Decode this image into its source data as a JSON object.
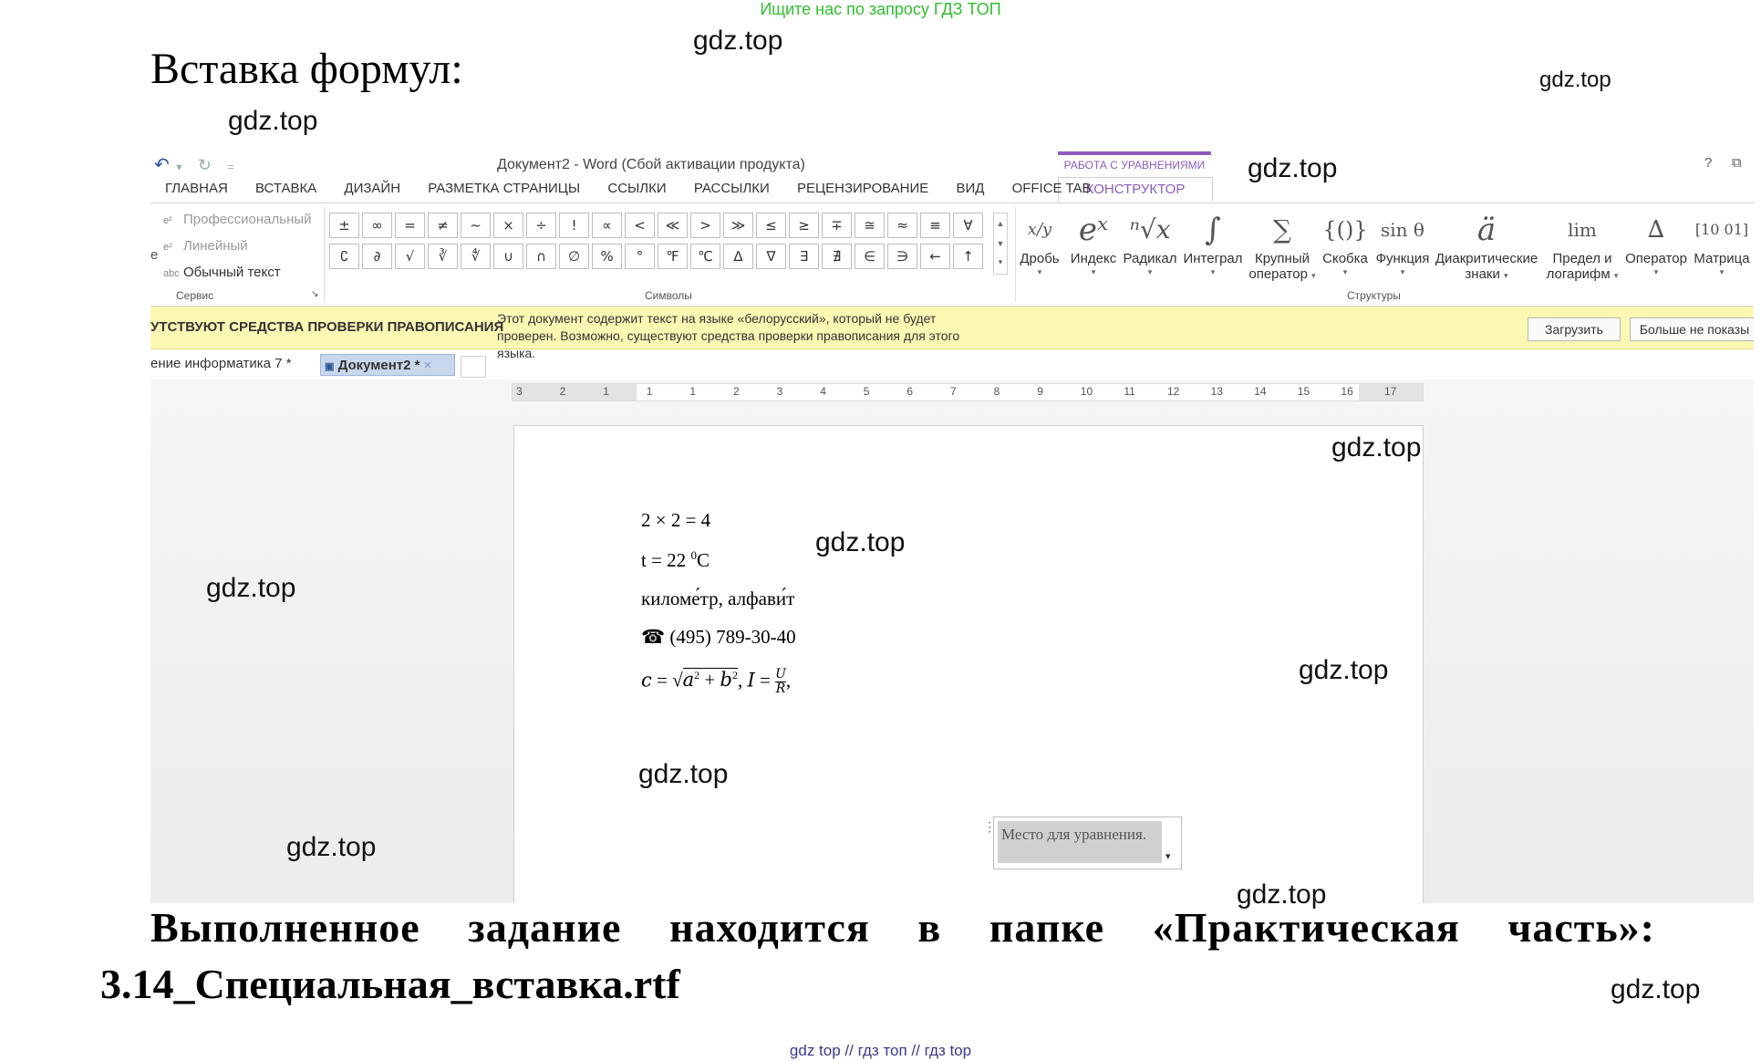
{
  "banner": "Ищите нас по запросу ГДЗ ТОП",
  "heading": "Вставка формул:",
  "watermark": "gdz.top",
  "word": {
    "quick_access": {
      "undo": "↶",
      "undo_arrow": "▾",
      "redo": "↻",
      "customize": "="
    },
    "title": "Документ2 - Word (Сбой активации продукта)",
    "context_group": "РАБОТА С УРАВНЕНИЯМИ",
    "context_tab": "КОНСТРУКТОР",
    "help": "?",
    "restore": "⧉",
    "tabs": [
      "ГЛАВНАЯ",
      "ВСТАВКА",
      "ДИЗАЙН",
      "РАЗМЕТКА СТРАНИЦЫ",
      "ССЫЛКИ",
      "РАССЫЛКИ",
      "РЕЦЕНЗИРОВАНИЕ",
      "ВИД",
      "OFFICE TAB"
    ],
    "service": {
      "items": [
        "Профессиональный",
        "Линейный",
        "Обычный текст"
      ],
      "cut_label": "e",
      "abc": "abc",
      "label": "Сервис",
      "launcher": "↘"
    },
    "symbols": {
      "label": "Символы",
      "row1": [
        "±",
        "∞",
        "=",
        "≠",
        "~",
        "×",
        "÷",
        "!",
        "∝",
        "<",
        "≪",
        ">",
        "≫",
        "≤",
        "≥",
        "∓",
        "≅",
        "≈",
        "≡",
        "∀"
      ],
      "row2": [
        "∁",
        "∂",
        "√",
        "∛",
        "∜",
        "∪",
        "∩",
        "∅",
        "%",
        "°",
        "℉",
        "℃",
        "∆",
        "∇",
        "∃",
        "∄",
        "∈",
        "∋",
        "←",
        "↑"
      ],
      "scroll": [
        "▲",
        "▼",
        "▾"
      ]
    },
    "structures": {
      "label": "Структуры",
      "items": [
        {
          "glyph": "x/y",
          "label": "Дробь",
          "label2": ""
        },
        {
          "glyph": "eˣ",
          "label": "Индекс",
          "label2": ""
        },
        {
          "glyph": "ⁿ√x",
          "label": "Радикал",
          "label2": ""
        },
        {
          "glyph": "∫",
          "label": "Интеграл",
          "label2": ""
        },
        {
          "glyph": "∑",
          "label": "Крупный",
          "label2": "оператор"
        },
        {
          "glyph": "{()}",
          "label": "Скобка",
          "label2": ""
        },
        {
          "glyph": "sin θ",
          "label": "Функция",
          "label2": ""
        },
        {
          "glyph": "ä",
          "label": "Диакритические",
          "label2": "знаки"
        },
        {
          "glyph": "lim",
          "label": "Предел и",
          "label2": "логарифм"
        },
        {
          "glyph": "∆",
          "label": "Оператор",
          "label2": ""
        },
        {
          "glyph": "[10 01]",
          "label": "Матрица",
          "label2": ""
        }
      ],
      "caret": "▾"
    },
    "infobar": {
      "title": "УТСТВУЮТ СРЕДСТВА ПРОВЕРКИ ПРАВОПИСАНИЯ",
      "text": "Этот документ содержит текст на языке «белорусский», который не будет проверен. Возможно, существуют средства проверки правописания для этого языка.",
      "btn_load": "Загрузить",
      "btn_never": "Больше не показы"
    },
    "doc_tabs": [
      "ение информатика 7 *",
      "Документ2 *"
    ],
    "doc_tab_close": "×",
    "ruler": [
      "3",
      "2",
      "1",
      "1",
      "1",
      "2",
      "3",
      "4",
      "5",
      "6",
      "7",
      "8",
      "9",
      "10",
      "11",
      "12",
      "13",
      "14",
      "15",
      "16",
      "17"
    ],
    "document": {
      "line1": "2 × 2 = 4",
      "line2_a": "t = 22 ",
      "line2_sup": "0",
      "line2_b": "C",
      "line3": "киломе́тр, алфави́т",
      "phone_icon": "☎",
      "line4": "(495) 789-30-40",
      "eq_c": "c",
      "eq_eq": "=",
      "eq_sqrt": "√",
      "eq_a": "a",
      "eq_2": "2",
      "eq_plus": "+",
      "eq_b": "b",
      "eq_comma": ",",
      "eq_I": "I",
      "eq_U": "U",
      "eq_R": "R",
      "eq_comma2": ",",
      "placeholder": "Место для уравнения.",
      "handle": "⋮",
      "ph_arrow": "▾"
    }
  },
  "conclusion": "Выполненное задание находится в папке «Практическая часть»:",
  "filename": "3.14_Специальная_вставка.rtf",
  "footer": "gdz top  //  гдз топ  //  гдз top"
}
